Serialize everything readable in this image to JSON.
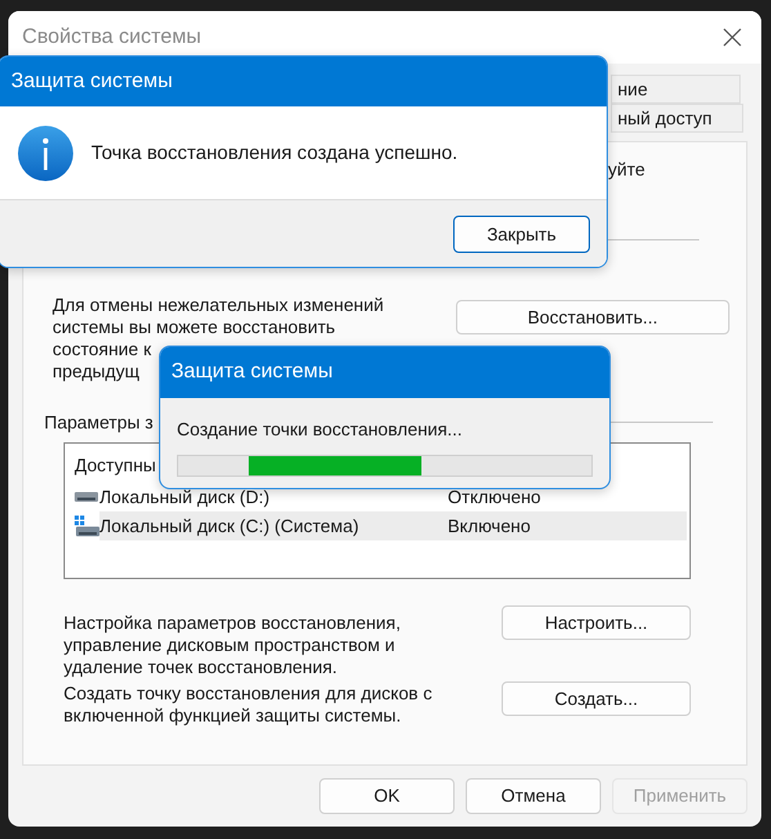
{
  "window": {
    "title": "Свойства системы"
  },
  "tabs": [
    {
      "label": "ние",
      "selected": false
    },
    {
      "label": "ный доступ",
      "selected": false
    }
  ],
  "panel_text": "уйте",
  "restore": {
    "text_lines": [
      "Для отмены нежелательных изменений",
      "системы вы можете восстановить",
      "состояние к",
      "предыдущ"
    ],
    "button": "Восстановить..."
  },
  "protection": {
    "label": "Параметры з",
    "list_header": "Доступны",
    "drives": [
      {
        "name": "Локальный диск (D:)",
        "status": "Отключено",
        "system": false,
        "selected": false
      },
      {
        "name": "Локальный диск (C:) (Система)",
        "status": "Включено",
        "system": true,
        "selected": true
      }
    ]
  },
  "configure": {
    "text": "Настройка параметров восстановления, управление дисковым пространством и удаление точек восстановления.",
    "button": "Настроить..."
  },
  "create": {
    "text": "Создать точку восстановления для дисков с включенной функцией защиты системы.",
    "button": "Создать..."
  },
  "footer_buttons": [
    {
      "label": "OK",
      "disabled": false
    },
    {
      "label": "Отмена",
      "disabled": false
    },
    {
      "label": "Применить",
      "disabled": true
    }
  ],
  "message_dialog": {
    "title": "Защита системы",
    "message": "Точка восстановления создана успешно.",
    "button": "Закрыть"
  },
  "progress_dialog": {
    "title": "Защита системы",
    "message": "Создание точки восстановления...",
    "indeterminate": true
  }
}
